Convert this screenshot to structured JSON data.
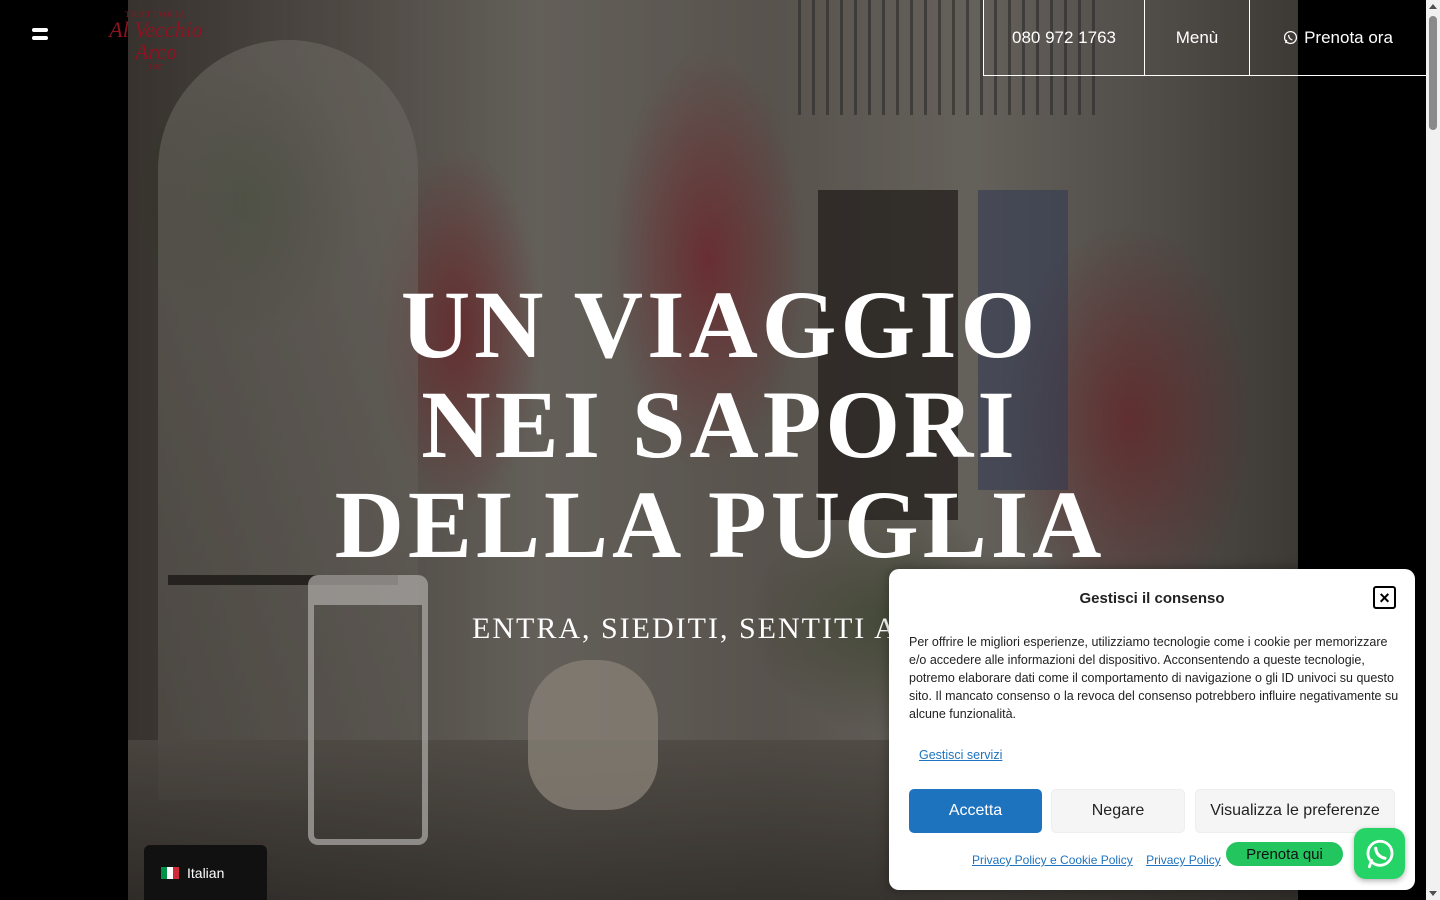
{
  "header": {
    "logo": {
      "top": "TRATTORIA",
      "name": "Al Vecchio Arco",
      "year": "1967"
    },
    "nav": {
      "phone": "080 972 1763",
      "menu": "Menù",
      "book": "Prenota ora"
    }
  },
  "hero": {
    "title_lines": [
      "UN VIAGGIO",
      "NEI SAPORI",
      "DELLA PUGLIA"
    ],
    "subtitle": "ENTRA, SIEDITI, SENTITI A C"
  },
  "consent": {
    "title": "Gestisci il consenso",
    "body": "Per offrire le migliori esperienze, utilizziamo tecnologie come i cookie per memorizzare e/o accedere alle informazioni del dispositivo. Acconsentendo a queste tecnologie, potremo elaborare dati come il comportamento di navigazione o gli ID univoci su questo sito. Il mancato consenso o la revoca del consenso potrebbero influire negativamente su alcune funzionalità.",
    "manage_services": "Gestisci servizi",
    "accept": "Accetta",
    "deny": "Negare",
    "preferences": "Visualizza le preferenze",
    "link_privacy_cookie": "Privacy Policy e Cookie Policy",
    "link_privacy": "Privacy Policy"
  },
  "language": {
    "label": "Italian"
  },
  "whatsapp": {
    "label": "Prenota qui"
  },
  "colors": {
    "accent": "#1e73be",
    "whatsapp": "#25d366",
    "logo": "#8f1222"
  },
  "icons": [
    "menu-icon",
    "whatsapp-icon",
    "close-icon",
    "italy-flag-icon"
  ]
}
